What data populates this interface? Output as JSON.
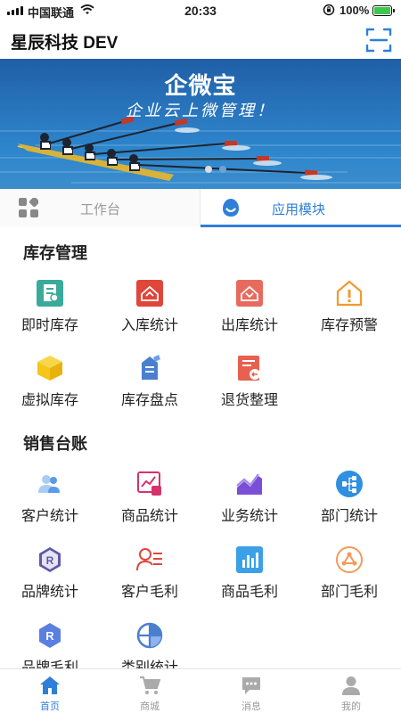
{
  "status_bar": {
    "carrier": "中国联通",
    "time": "20:33",
    "battery": "100%"
  },
  "header": {
    "title": "星辰科技 DEV",
    "scan_icon": "scan-icon"
  },
  "banner": {
    "logo_text": "企微宝",
    "slogan": "企业云上微管理！",
    "pager_dots": 2,
    "active_dot": 0
  },
  "tabs": [
    {
      "label": "工作台",
      "icon": "grid-icon",
      "active": false
    },
    {
      "label": "应用模块",
      "icon": "cloud-smile-icon",
      "active": true
    }
  ],
  "sections": [
    {
      "title": "库存管理",
      "items": [
        {
          "label": "即时库存",
          "icon": "instant-stock-icon",
          "color": "#3aab9a"
        },
        {
          "label": "入库统计",
          "icon": "inbound-icon",
          "color": "#e0463a"
        },
        {
          "label": "出库统计",
          "icon": "outbound-icon",
          "color": "#e86a5e"
        },
        {
          "label": "库存预警",
          "icon": "warning-house-icon",
          "color": "#f29a2e"
        },
        {
          "label": "虚拟库存",
          "icon": "virtual-box-icon",
          "color": "#f5c518"
        },
        {
          "label": "库存盘点",
          "icon": "stocktake-icon",
          "color": "#4a7fd0"
        },
        {
          "label": "退货整理",
          "icon": "return-icon",
          "color": "#e8604f"
        }
      ]
    },
    {
      "title": "销售台账",
      "items": [
        {
          "label": "客户统计",
          "icon": "customers-icon",
          "color": "#5b9ae8"
        },
        {
          "label": "商品统计",
          "icon": "goods-chart-icon",
          "color": "#d6326a"
        },
        {
          "label": "业务统计",
          "icon": "business-chart-icon",
          "color": "#7a4fd6"
        },
        {
          "label": "部门统计",
          "icon": "department-icon",
          "color": "#2f8fe0"
        },
        {
          "label": "品牌统计",
          "icon": "brand-icon",
          "color": "#5e5aa8"
        },
        {
          "label": "客户毛利",
          "icon": "customer-profit-icon",
          "color": "#e0463a"
        },
        {
          "label": "商品毛利",
          "icon": "goods-profit-icon",
          "color": "#3aa0e8"
        },
        {
          "label": "部门毛利",
          "icon": "department-profit-icon",
          "color": "#f29a5a"
        },
        {
          "label": "品牌毛利",
          "icon": "brand-profit-icon",
          "color": "#5b7fe0"
        },
        {
          "label": "类别统计",
          "icon": "category-icon",
          "color": "#4a7fd0"
        }
      ]
    }
  ],
  "tabbar": [
    {
      "label": "首页",
      "icon": "home-icon",
      "active": true
    },
    {
      "label": "商城",
      "icon": "cart-icon",
      "active": false
    },
    {
      "label": "消息",
      "icon": "message-icon",
      "active": false
    },
    {
      "label": "我的",
      "icon": "user-icon",
      "active": false
    }
  ],
  "colors": {
    "accent": "#2f7fd8",
    "inactive": "#999999"
  }
}
